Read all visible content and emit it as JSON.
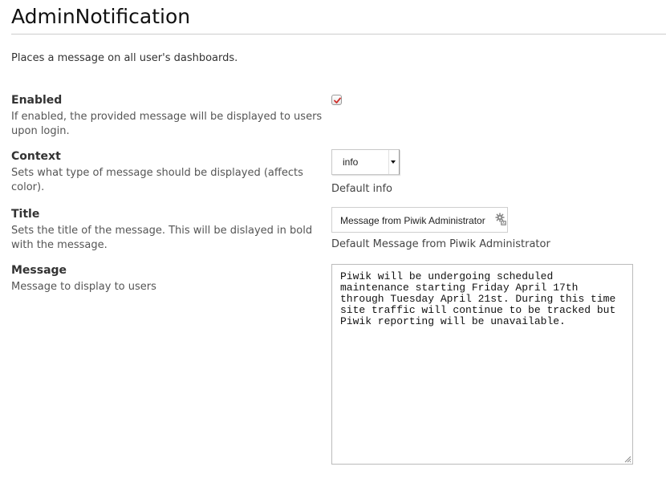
{
  "header": {
    "title": "AdminNotification",
    "description": "Places a message on all user's dashboards."
  },
  "settings": {
    "enabled": {
      "label": "Enabled",
      "help": "If enabled, the provided message will be displayed to users upon login.",
      "checked": true,
      "check_color": "#d0312d"
    },
    "context": {
      "label": "Context",
      "help": "Sets what type of message should be displayed (affects color).",
      "selected": "info",
      "default_text": "Default info"
    },
    "title": {
      "label": "Title",
      "help": "Sets the title of the message. This will be dislayed in bold with the message.",
      "value": "Message from Piwik Administrator",
      "default_text": "Default Message from Piwik Administrator",
      "icon": "autofill-icon"
    },
    "message": {
      "label": "Message",
      "help": "Message to display to users",
      "value": "Piwik will be undergoing scheduled maintenance starting Friday April 17th through Tuesday April 21st. During this time site traffic will continue to be tracked but Piwik reporting will be unavailable.",
      "icon": "resize-grip-icon"
    }
  }
}
